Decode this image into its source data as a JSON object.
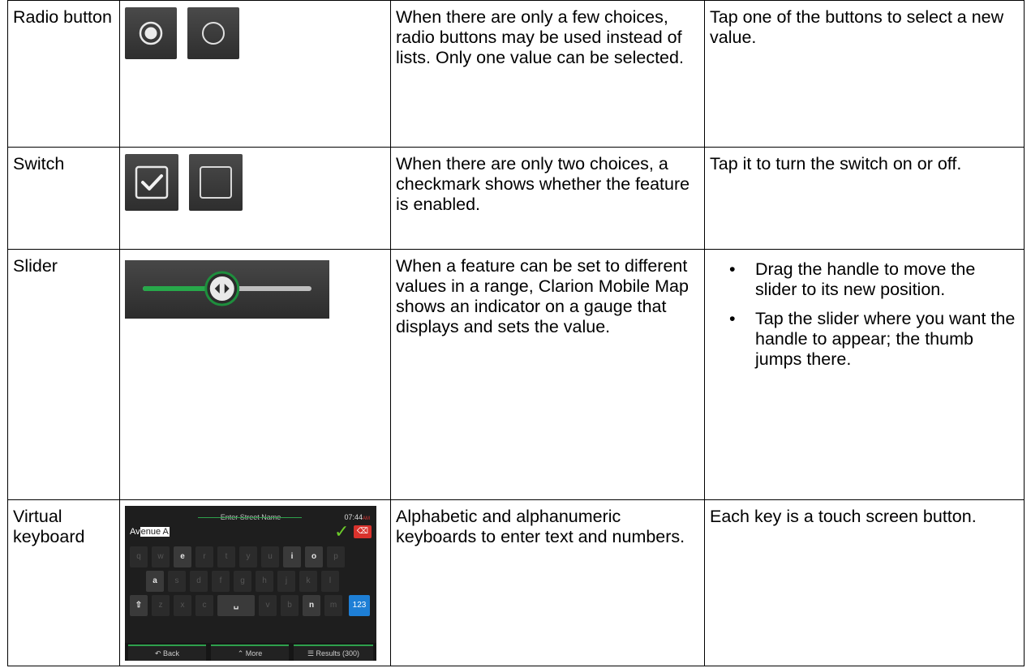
{
  "rows": [
    {
      "name": "Radio button",
      "description": "When there are only a few choices, radio buttons may be used instead of lists. Only one value can be selected.",
      "action": "Tap one of the buttons to select a new value."
    },
    {
      "name": "Switch",
      "description": "When there are only two choices, a checkmark shows whether the feature is enabled.",
      "action": "Tap it to turn the switch on or off."
    },
    {
      "name": "Slider",
      "description": "When a feature can be set to different values in a range, Clarion Mobile Map shows an indicator on a gauge that displays and sets the value.",
      "actions": [
        "Drag the handle to move the slider to its new position.",
        "Tap the slider where you want the handle to appear; the thumb jumps there."
      ],
      "slider_level": 0.47
    },
    {
      "name": "Virtual keyboard",
      "description": "Alphabetic and alphanumeric keyboards to enter text and numbers.",
      "action": "Each key is a touch screen button.",
      "keyboard": {
        "title": "Enter Street Name",
        "time": "07:44",
        "ampm": "AM",
        "field_typed": "Av",
        "field_selected": "enue A",
        "row1": [
          "q",
          "w",
          "e",
          "r",
          "t",
          "y",
          "u",
          "i",
          "o",
          "p"
        ],
        "row2": [
          "a",
          "s",
          "d",
          "f",
          "g",
          "h",
          "j",
          "k",
          "l"
        ],
        "row3_mid": [
          "z",
          "x",
          "c",
          "␣",
          "v",
          "b",
          "n",
          "m"
        ],
        "num_key": "123",
        "back_label": "Back",
        "more_label": "More",
        "results_label": "Results (300)",
        "accent_color": "#2ea04c"
      }
    }
  ]
}
